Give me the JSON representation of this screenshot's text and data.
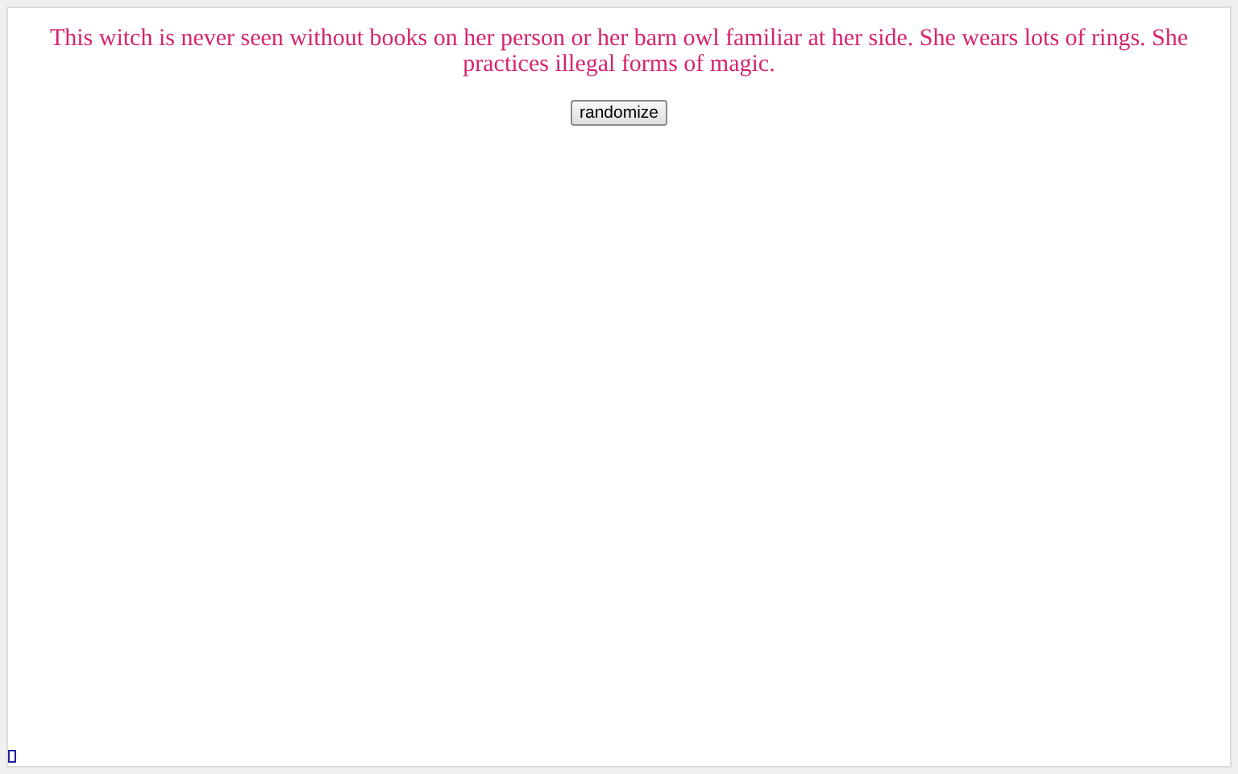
{
  "description": "This witch is never seen without books on her person or her barn owl familiar at her side. She wears lots of rings. She practices illegal forms of magic.",
  "buttons": [
    "randomize"
  ]
}
